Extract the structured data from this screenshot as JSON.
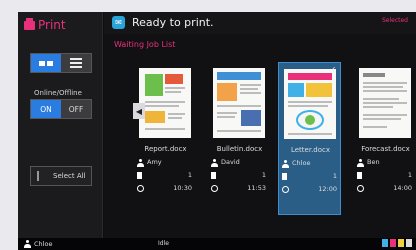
{
  "app": {
    "title": "Print"
  },
  "sidebar": {
    "online_label": "Online/Offline",
    "on_label": "ON",
    "off_label": "OFF",
    "select_all_label": "Select All"
  },
  "header": {
    "status": "Ready to print.",
    "selected_label": "Selected"
  },
  "main": {
    "list_title": "Waiting Job List",
    "jobs": [
      {
        "file": "Report.docx",
        "user": "Amy",
        "copies": "1",
        "time": "10:30",
        "selected": false
      },
      {
        "file": "Bulletin.docx",
        "user": "David",
        "copies": "1",
        "time": "11:53",
        "selected": false
      },
      {
        "file": "Letter.docx",
        "user": "Chloe",
        "copies": "1",
        "time": "12:00",
        "selected": true
      },
      {
        "file": "Forecast.docx",
        "user": "Ben",
        "copies": "1",
        "time": "14:00",
        "selected": false
      }
    ]
  },
  "footer": {
    "user": "Chloe",
    "status": "Idle"
  },
  "colors": {
    "accent": "#e8317a",
    "selection": "#2a7ce0",
    "background": "#0e0e10"
  },
  "icons": [
    "printer-icon",
    "status-icon",
    "grid-view-icon",
    "list-view-icon",
    "user-icon",
    "document-icon",
    "clock-icon",
    "menu-icon",
    "arrow-left-icon",
    "arrow-right-icon"
  ]
}
